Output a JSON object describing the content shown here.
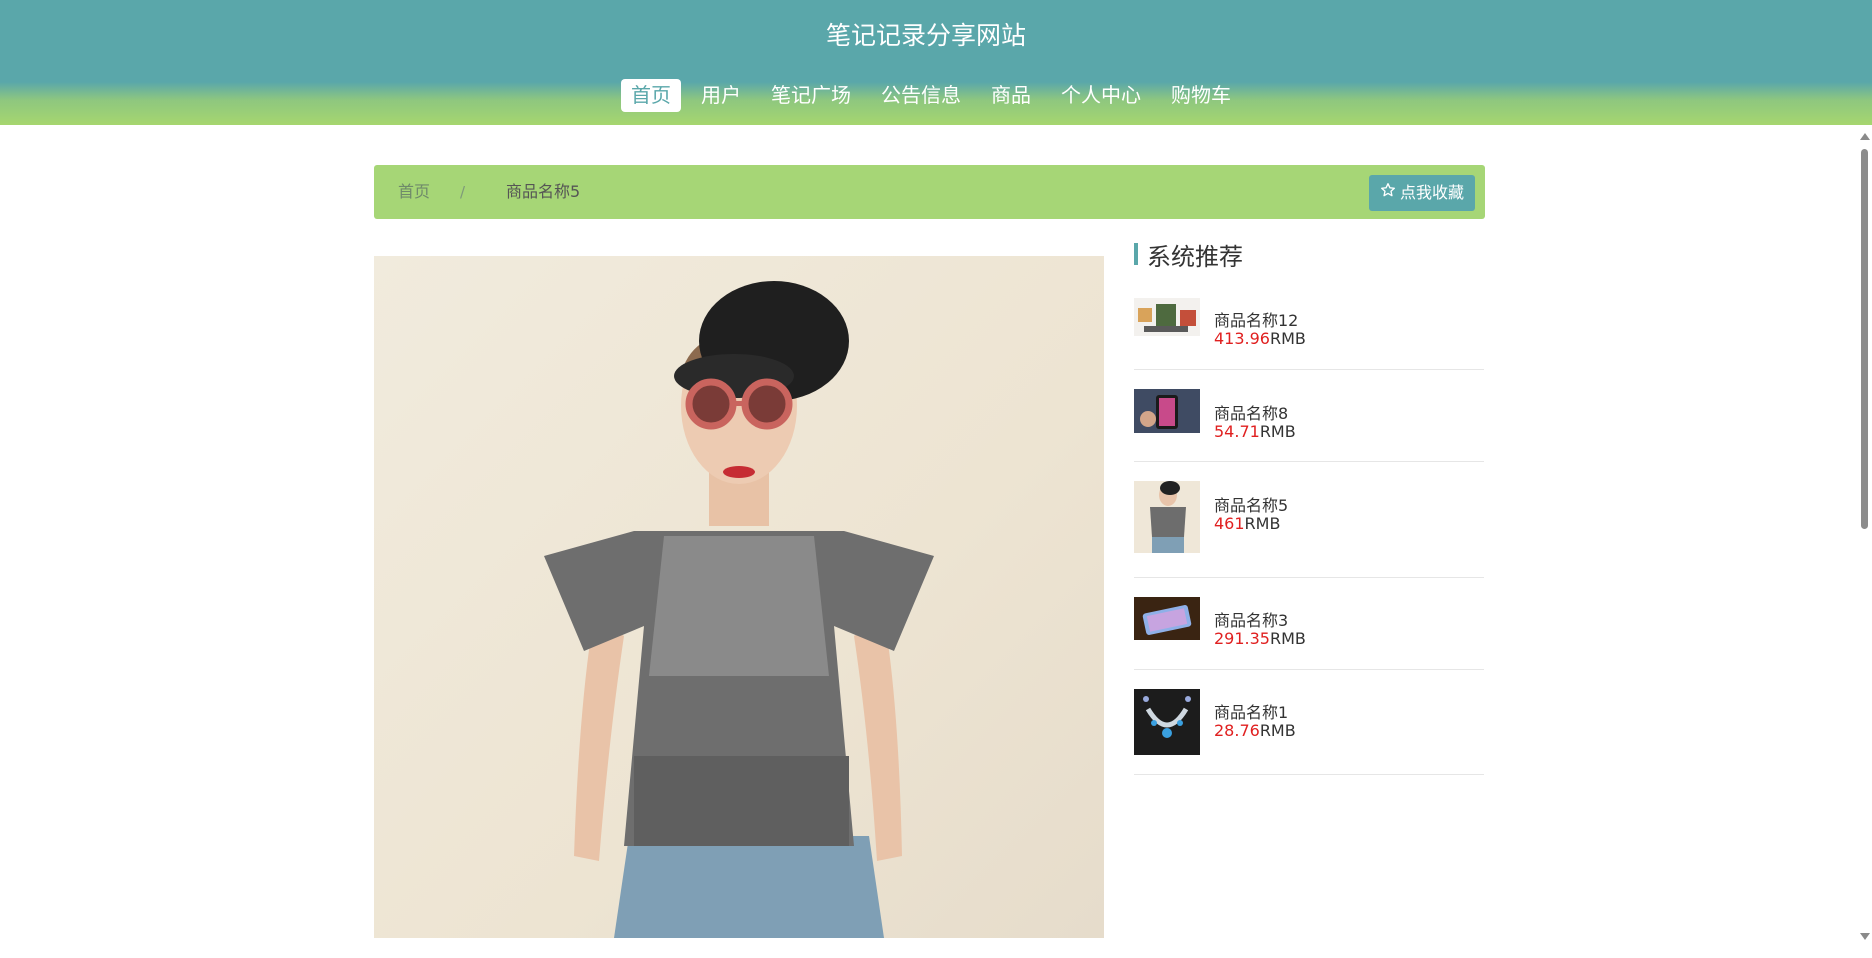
{
  "header": {
    "site_title": "笔记记录分享网站",
    "nav": [
      {
        "label": "首页",
        "active": true
      },
      {
        "label": "用户"
      },
      {
        "label": "笔记广场"
      },
      {
        "label": "公告信息"
      },
      {
        "label": "商品"
      },
      {
        "label": "个人中心"
      },
      {
        "label": "购物车"
      }
    ]
  },
  "breadcrumb": {
    "home": "首页",
    "separator": "/",
    "current": "商品名称5",
    "favorite_button": "点我收藏"
  },
  "sidebar": {
    "title": "系统推荐",
    "items": [
      {
        "name": "商品名称12",
        "price": "413.96",
        "unit": "RMB"
      },
      {
        "name": "商品名称8",
        "price": "54.71",
        "unit": "RMB"
      },
      {
        "name": "商品名称5",
        "price": "461",
        "unit": "RMB"
      },
      {
        "name": "商品名称3",
        "price": "291.35",
        "unit": "RMB"
      },
      {
        "name": "商品名称1",
        "price": "28.76",
        "unit": "RMB"
      }
    ]
  },
  "colors": {
    "header_teal": "#5aa7aa",
    "header_green": "#a6d66f",
    "breadcrumb_bg": "#a6d676",
    "price_red": "#e02020"
  }
}
